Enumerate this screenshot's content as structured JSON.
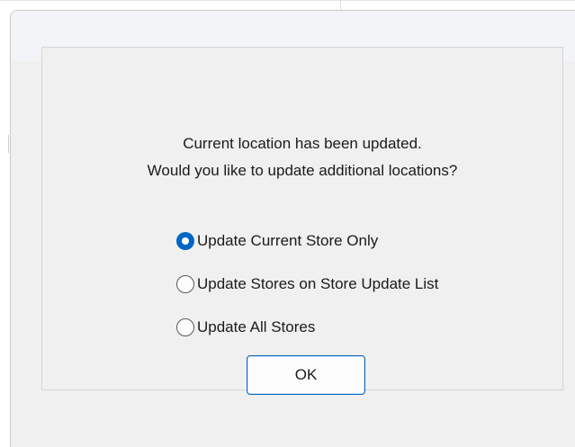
{
  "dialog": {
    "message_line1": "Current location has been updated.",
    "message_line2": "Would you like to update additional locations?",
    "options": [
      {
        "label": "Update Current Store Only",
        "selected": true
      },
      {
        "label": "Update Stores on Store Update List",
        "selected": false
      },
      {
        "label": "Update All Stores",
        "selected": false
      }
    ],
    "ok_label": "OK"
  },
  "colors": {
    "accent": "#0066c4",
    "window_background": "#f0f0f0"
  }
}
